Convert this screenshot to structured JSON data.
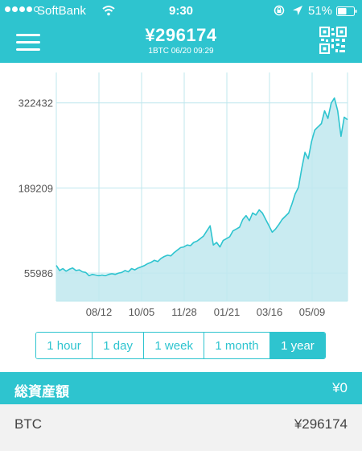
{
  "status_bar": {
    "carrier": "SoftBank",
    "time": "9:30",
    "battery": "51%"
  },
  "header": {
    "price": "¥296174",
    "subtitle": "1BTC   06/20 09:29"
  },
  "colors": {
    "accent": "#2ec4cf",
    "area_fill": "#bfe7ee",
    "line": "#2ec4cf",
    "row_bg": "#f2f2f2"
  },
  "range_selector": {
    "options": [
      "1 hour",
      "1 day",
      "1 week",
      "1 month",
      "1 year"
    ],
    "selected": "1 year"
  },
  "assets": {
    "label": "総資産額",
    "value": "¥0"
  },
  "holdings": [
    {
      "currency": "BTC",
      "value": "¥296174"
    }
  ],
  "chart_data": {
    "type": "area",
    "y_ticks": [
      55986,
      189209,
      322432
    ],
    "x_ticks": [
      "08/12",
      "10/05",
      "11/28",
      "01/21",
      "03/16",
      "05/09"
    ],
    "ylim": [
      12000,
      370000
    ],
    "grid": true,
    "series": [
      {
        "values": [
          68000,
          60000,
          63000,
          59000,
          62000,
          64000,
          60000,
          61000,
          58000,
          57000,
          52000,
          54000,
          53000,
          52000,
          53000,
          52000,
          54000,
          55000,
          54000,
          56000,
          57000,
          60000,
          58000,
          63000,
          61000,
          64000,
          66000,
          68000,
          71000,
          73000,
          76000,
          74000,
          79000,
          82000,
          84000,
          83000,
          88000,
          92000,
          96000,
          97000,
          100000,
          99000,
          104000,
          106000,
          110000,
          114000,
          122000,
          130000,
          100000,
          104000,
          97000,
          107000,
          110000,
          113000,
          122000,
          125000,
          128000,
          140000,
          146000,
          138000,
          150000,
          147000,
          155000,
          150000,
          140000,
          130000,
          120000,
          125000,
          132000,
          140000,
          145000,
          150000,
          164000,
          180000,
          190000,
          220000,
          245000,
          235000,
          262000,
          280000,
          285000,
          290000,
          310000,
          298000,
          322000,
          330000,
          310000,
          270000,
          300000,
          296174
        ]
      }
    ]
  }
}
